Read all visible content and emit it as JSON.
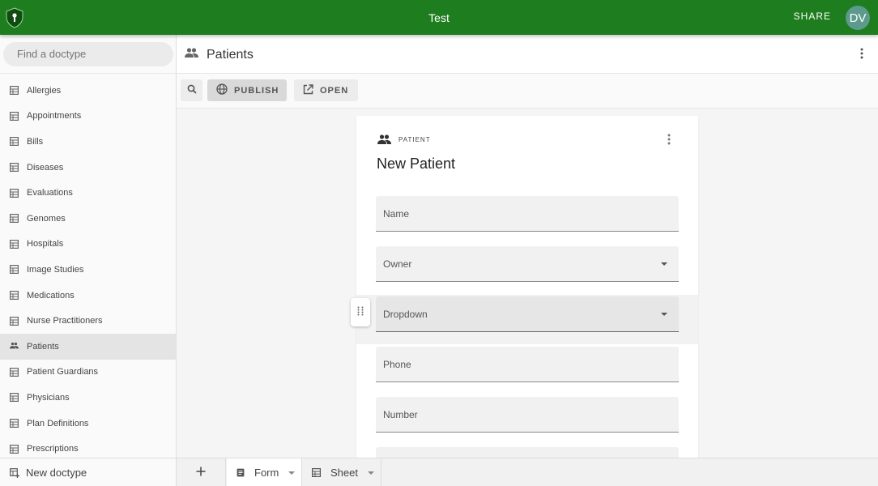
{
  "app": {
    "title": "Test",
    "share_label": "SHARE",
    "avatar_initials": "DV",
    "brand_color": "#1e7d1e"
  },
  "sidebar": {
    "search_placeholder": "Find a doctype",
    "items": [
      {
        "label": "Allergies",
        "icon": "table-icon"
      },
      {
        "label": "Appointments",
        "icon": "table-icon"
      },
      {
        "label": "Bills",
        "icon": "table-icon"
      },
      {
        "label": "Diseases",
        "icon": "table-icon"
      },
      {
        "label": "Evaluations",
        "icon": "table-icon"
      },
      {
        "label": "Genomes",
        "icon": "table-icon"
      },
      {
        "label": "Hospitals",
        "icon": "table-icon"
      },
      {
        "label": "Image Studies",
        "icon": "table-icon"
      },
      {
        "label": "Medications",
        "icon": "table-icon"
      },
      {
        "label": "Nurse Practitioners",
        "icon": "table-icon"
      },
      {
        "label": "Patients",
        "icon": "people-icon",
        "active": true
      },
      {
        "label": "Patient Guardians",
        "icon": "table-icon"
      },
      {
        "label": "Physicians",
        "icon": "table-icon"
      },
      {
        "label": "Plan Definitions",
        "icon": "table-icon"
      },
      {
        "label": "Prescriptions",
        "icon": "table-icon"
      }
    ],
    "new_doctype_label": "New doctype"
  },
  "header": {
    "title": "Patients"
  },
  "toolbar": {
    "publish_label": "PUBLISH",
    "open_label": "OPEN"
  },
  "form": {
    "kind_label": "PATIENT",
    "title": "New Patient",
    "fields": [
      {
        "label": "Name",
        "type": "text"
      },
      {
        "label": "Owner",
        "type": "select"
      },
      {
        "label": "Dropdown",
        "type": "select",
        "focused": true
      },
      {
        "label": "Phone",
        "type": "text"
      },
      {
        "label": "Number",
        "type": "text"
      }
    ]
  },
  "bottom_tabs": [
    {
      "label": "Form",
      "icon": "form-icon",
      "active": true
    },
    {
      "label": "Sheet",
      "icon": "table-icon",
      "active": false
    }
  ]
}
